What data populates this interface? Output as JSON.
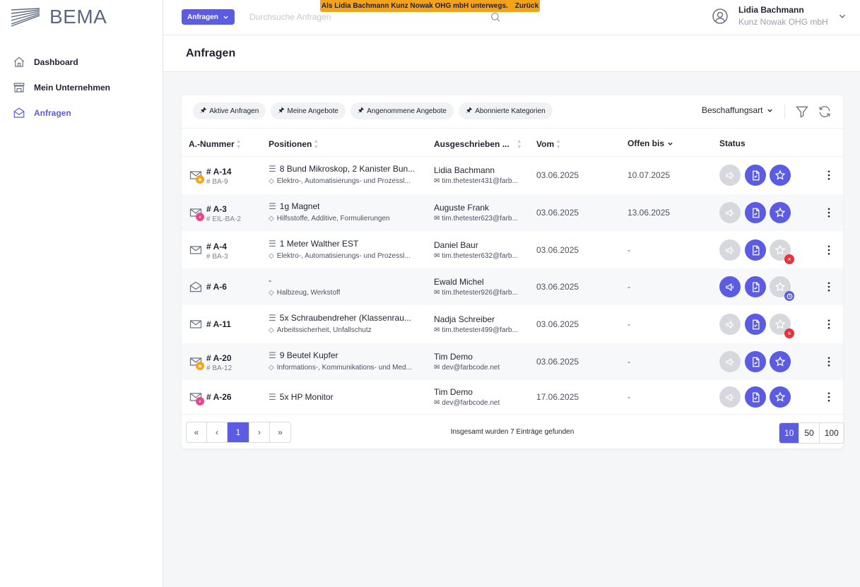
{
  "app": {
    "logo_text": "BEMA"
  },
  "sidebar": {
    "items": [
      {
        "label": "Dashboard",
        "icon": "home-icon"
      },
      {
        "label": "Mein Unternehmen",
        "icon": "building-icon"
      },
      {
        "label": "Anfragen",
        "icon": "mail-open-icon",
        "active": true
      }
    ]
  },
  "topbar": {
    "button_label": "Anfragen",
    "search_placeholder": "Durchsuche Anfragen",
    "banner_text": "Als Lidia Bachmann Kunz Nowak OHG mbH unterwegs.",
    "banner_back": "Zurück",
    "user_name": "Lidia Bachmann",
    "user_org": "Kunz Nowak OHG mbH"
  },
  "page": {
    "title": "Anfragen"
  },
  "filters": {
    "chips": [
      "Aktive Anfragen",
      "Meine Angebote",
      "Angenommene Angebote",
      "Abonnierte Kategorien"
    ],
    "dropdown": "Beschaffungsart"
  },
  "table": {
    "headers": [
      "A.-Nummer",
      "Positionen",
      "Ausgeschrieben ...",
      "Vom",
      "Offen bis",
      "Status"
    ],
    "rows": [
      {
        "num": "# A-14",
        "sub": "# BA-9",
        "icon_badge": "star",
        "pos": "8 Bund Mikroskop, 2 Kanister Bun...",
        "cat": "Elektro-, Automatisierungs- und Prozessl...",
        "name": "Lidia Bachmann",
        "email": "tim.thetester431@farb...",
        "vom": "03.06.2025",
        "offen": "10.07.2025",
        "s1": "gray",
        "s2": "pur",
        "s3": "pur",
        "s3_badge": ""
      },
      {
        "num": "# A-3",
        "sub": "# EIL-BA-2",
        "icon_badge": "fire",
        "pos": "1g Magnet",
        "cat": "Hilfsstoffe, Additive, Formulierungen",
        "name": "Auguste Frank",
        "email": "tim.thetester623@farb...",
        "vom": "03.06.2025",
        "offen": "13.06.2025",
        "s1": "gray",
        "s2": "pur",
        "s3": "pur",
        "s3_badge": ""
      },
      {
        "num": "# A-4",
        "sub": "# BA-3",
        "icon_badge": "",
        "pos": "1 Meter Walther EST",
        "cat": "Elektro-, Automatisierungs- und Prozessl...",
        "name": "Daniel Baur",
        "email": "tim.thetester632@farb...",
        "vom": "03.06.2025",
        "offen": "-",
        "s1": "gray",
        "s2": "pur",
        "s3": "gray",
        "s3_badge": "x"
      },
      {
        "num": "# A-6",
        "sub": "",
        "icon_badge": "",
        "open_icon": true,
        "pos": "-",
        "no_pos_icon": true,
        "cat": "Halbzeug, Werkstoff",
        "name": "Ewald Michel",
        "email": "tim.thetester926@farb...",
        "vom": "03.06.2025",
        "offen": "-",
        "s1": "pur",
        "s2": "pur",
        "s3": "gray",
        "s3_badge": "clock"
      },
      {
        "num": "# A-11",
        "sub": "",
        "icon_badge": "",
        "pos": "5x Schraubendreher (Klassenrau...",
        "cat": "Arbeitssicherheit, Unfallschutz",
        "name": "Nadja Schreiber",
        "email": "tim.thetester499@farb...",
        "vom": "03.06.2025",
        "offen": "-",
        "s1": "gray",
        "s2": "pur",
        "s3": "gray",
        "s3_badge": "x"
      },
      {
        "num": "# A-20",
        "sub": "# BA-12",
        "icon_badge": "star",
        "pos": "9 Beutel Kupfer",
        "cat": "Informations-, Kommunikations- und Med...",
        "name": "Tim Demo",
        "email": "dev@farbcode.net",
        "vom": "03.06.2025",
        "offen": "-",
        "s1": "gray",
        "s2": "pur",
        "s3": "pur",
        "s3_badge": ""
      },
      {
        "num": "# A-26",
        "sub": "",
        "icon_badge": "fire",
        "pos": "5x HP Monitor",
        "cat": "",
        "name": "Tim Demo",
        "email": "dev@farbcode.net",
        "vom": "17.06.2025",
        "offen": "-",
        "s1": "gray",
        "s2": "pur",
        "s3": "pur",
        "s3_badge": ""
      }
    ]
  },
  "pagination": {
    "current": "1",
    "total_text": "Insgesamt wurden 7 Einträge gefunden",
    "sizes": [
      "10",
      "50",
      "100"
    ],
    "current_size": "10"
  },
  "colors": {
    "accent": "#5b5ce2",
    "banner": "#f5a21b",
    "badge_red": "#e8323c",
    "badge_star": "#f5a21b",
    "badge_fire": "#e8478b"
  }
}
